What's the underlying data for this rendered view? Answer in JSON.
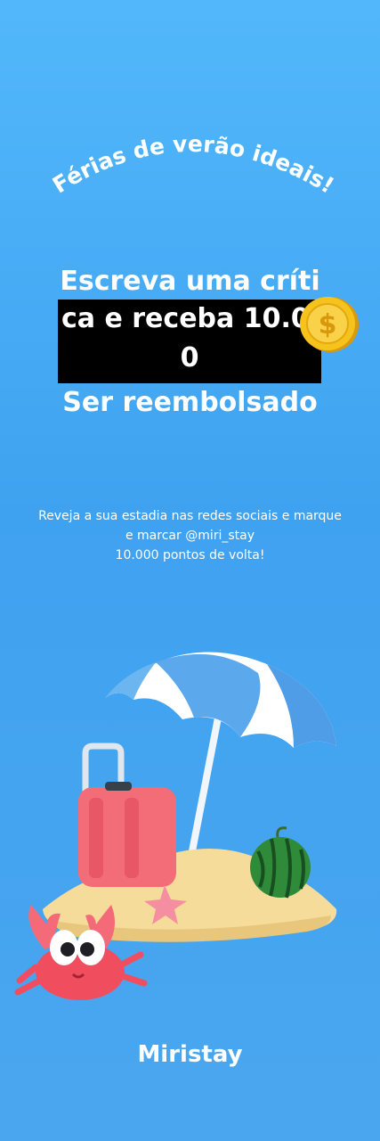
{
  "promo": {
    "arc_title": "Férias de verão ideais!",
    "headline": {
      "line1": "Escreva uma críti",
      "line2": "ca e receba 10.0",
      "line3": "0",
      "line4": "Ser reembolsado"
    },
    "description": [
      "Reveja a sua estadia nas redes sociais e marque",
      "e marcar @miri_stay",
      "10.000 pontos de volta!"
    ],
    "brand": "Miristay"
  },
  "colors": {
    "background_top": "#52b8fb",
    "background_bottom": "#4aa6ef",
    "text": "#ffffff",
    "highlight_box": "#000000",
    "coin": "#f6c21c"
  },
  "icons": {
    "coin": "gold-coin-icon",
    "scene": "beach-vacation-illustration"
  }
}
